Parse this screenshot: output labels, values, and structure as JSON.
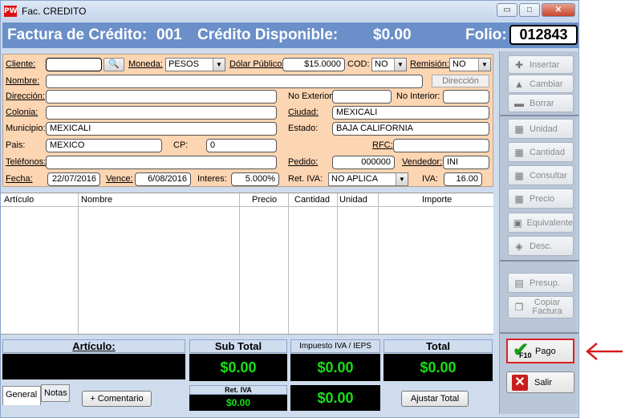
{
  "window": {
    "app_icon": "PW",
    "title": "Fac. CREDITO",
    "minimize": "▭",
    "maximize": "□",
    "close": "✕"
  },
  "header": {
    "title": "Factura de Crédito:",
    "number": "001",
    "credit_label": "Crédito Disponible:",
    "credit_value": "$0.00",
    "folio_label": "Folio:",
    "folio_value": "012843"
  },
  "form": {
    "cliente_label": "Cliente:",
    "cliente_value": "",
    "moneda_label": "Moneda:",
    "moneda_value": "PESOS",
    "dolar_label": "Dólar Público:",
    "dolar_value": "$15.0000",
    "cod_label": "COD:",
    "cod_value": "NO",
    "remision_label": "Remisión:",
    "remision_value": "NO",
    "nombre_label": "Nombre:",
    "nombre_value": "",
    "direccion_button": "Dirección",
    "direccion_label": "Dirección:",
    "direccion_value": "",
    "no_exterior_label": "No Exterior:",
    "no_exterior_value": "",
    "no_interior_label": "No Interior:",
    "no_interior_value": "",
    "colonia_label": "Colonia:",
    "colonia_value": "",
    "ciudad_label": "Ciudad:",
    "ciudad_value": "MEXICALI",
    "municipio_label": "Municipio:",
    "municipio_value": "MEXICALI",
    "estado_label": "Estado:",
    "estado_value": "BAJA CALIFORNIA",
    "pais_label": "Pais:",
    "pais_value": "MEXICO",
    "cp_label": "CP:",
    "cp_value": "0",
    "rfc_label": "RFC:",
    "rfc_value": "",
    "telefonos_label": "Teléfonos:",
    "telefonos_value": "",
    "pedido_label": "Pedido:",
    "pedido_value": "000000",
    "vendedor_label": "Vendedor:",
    "vendedor_value": "INI",
    "fecha_label": "Fecha:",
    "fecha_value": "22/07/2016",
    "vence_label": "Vence:",
    "vence_value": "6/08/2016",
    "interes_label": "Interes:",
    "interes_value": "5.000%",
    "ret_iva_label": "Ret. IVA:",
    "ret_iva_value": "NO APLICA",
    "iva_label": "IVA:",
    "iva_value": "16.00"
  },
  "grid": {
    "columns": [
      "Artículo",
      "Nombre",
      "Precio",
      "Cantidad",
      "Unidad",
      "Importe"
    ]
  },
  "sidebar": {
    "insertar": "Insertar",
    "cambiar": "Cambiar",
    "borrar": "Borrar",
    "unidad": "Unidad",
    "cantidad": "Cantidad",
    "consultar": "Consultar",
    "precio": "Precio",
    "equivalente": "Equivalente",
    "desc": "Desc.",
    "presup": "Presup.",
    "copiar_factura": "Copiar Factura",
    "pago": "Pago",
    "pago_key": "F10",
    "salir": "Salir"
  },
  "totals": {
    "articulo_label": "Artículo:",
    "subtotal_label": "Sub Total",
    "subtotal_value": "$0.00",
    "impuesto_label": "Impuesto IVA / IEPS",
    "impuesto_value": "$0.00",
    "total_label": "Total",
    "total_value": "$0.00",
    "ret_iva_label": "Ret. IVA",
    "ret_iva_value": "$0.00",
    "ret_total_value": "$0.00"
  },
  "bottom": {
    "tab_general": "General",
    "tab_notas": "Notas",
    "comentario_button": "+ Comentario",
    "ajustar_button": "Ajustar Total"
  }
}
